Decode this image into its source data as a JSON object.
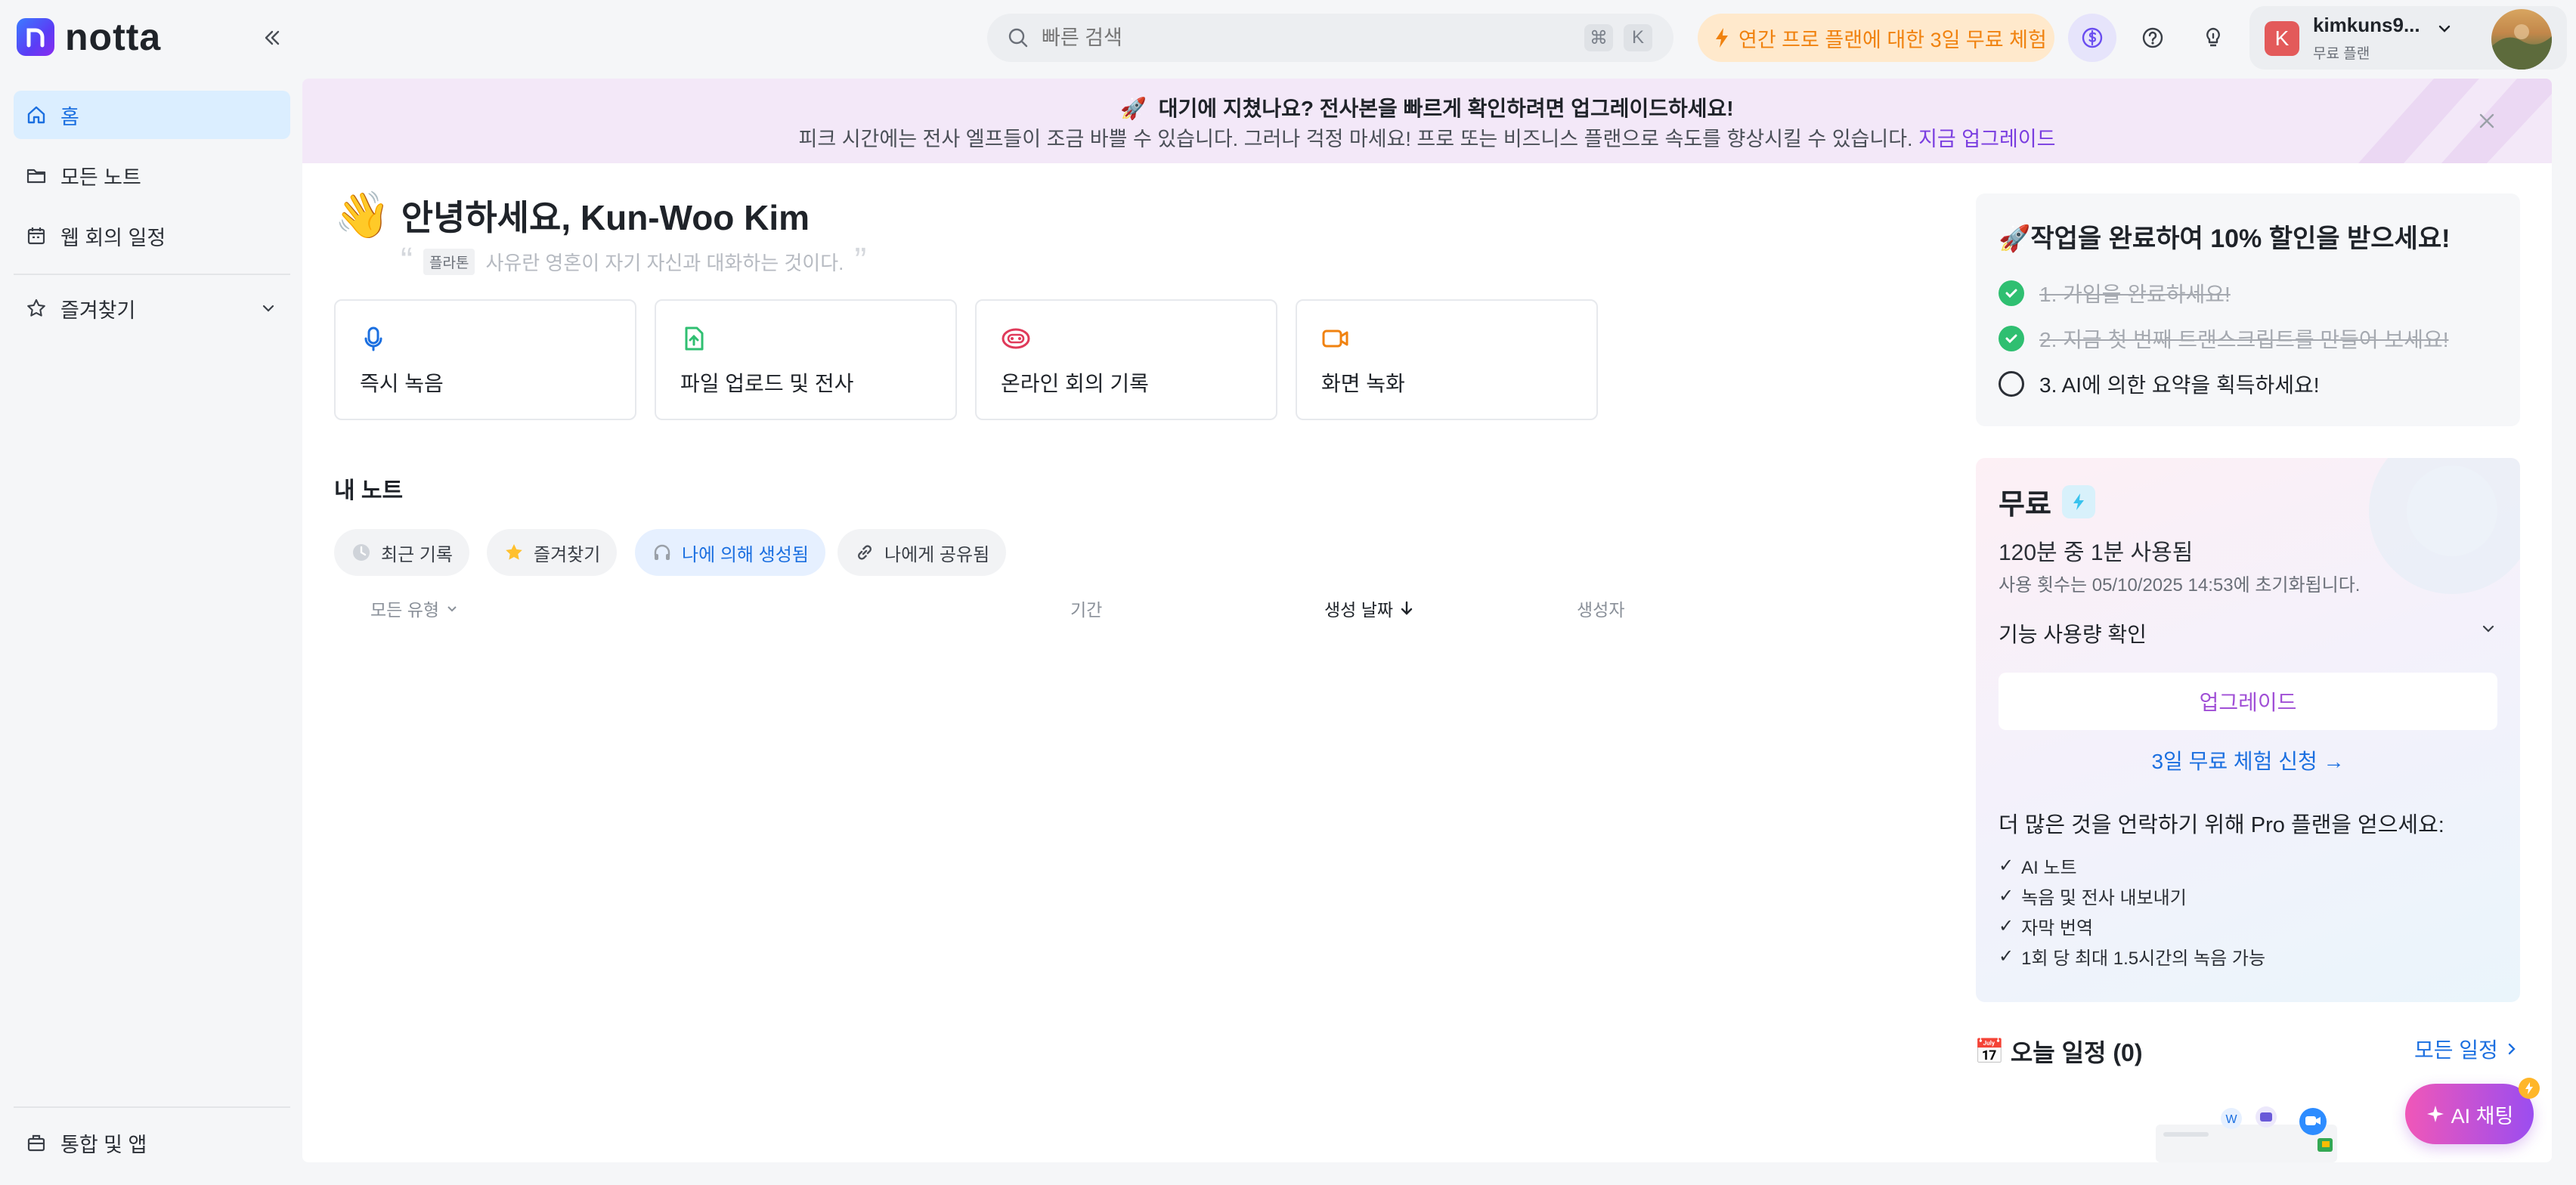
{
  "app": {
    "logo_text": "notta"
  },
  "sidebar": {
    "items": [
      {
        "label": "홈"
      },
      {
        "label": "모든 노트"
      },
      {
        "label": "웹 회의 일정"
      },
      {
        "label": "즐겨찾기"
      }
    ],
    "bottom_item": {
      "label": "통합 및 앱"
    }
  },
  "topbar": {
    "search_placeholder": "빠른 검색",
    "kbd_cmd": "⌘",
    "kbd_key": "K",
    "trial_label": "연간 프로 플랜에 대한 3일 무료 체험",
    "account_name": "kimkuns9...",
    "account_plan": "무료 플랜",
    "account_initial": "K"
  },
  "banner": {
    "title": "대기에 지쳤나요? 전사본을 빠르게 확인하려면 업그레이드하세요!",
    "subtitle": "피크 시간에는 전사 엘프들이 조금 바쁠 수 있습니다. 그러나 걱정 마세요! 프로 또는 비즈니스 플랜으로 속도를 향상시킬 수 있습니다.",
    "link": "지금 업그레이드"
  },
  "greeting": {
    "title": "안녕하세요, Kun-Woo Kim",
    "quote_tag": "플라톤",
    "quote": "사유란 영혼이 자기 자신과 대화하는 것이다."
  },
  "actions": [
    {
      "label": "즉시 녹음"
    },
    {
      "label": "파일 업로드 및 전사"
    },
    {
      "label": "온라인 회의 기록"
    },
    {
      "label": "화면 녹화"
    }
  ],
  "notes": {
    "title": "내 노트",
    "tabs": [
      {
        "label": "최근 기록"
      },
      {
        "label": "즐겨찾기"
      },
      {
        "label": "나에 의해 생성됨"
      },
      {
        "label": "나에게 공유됨"
      }
    ],
    "columns": {
      "type": "모든 유형",
      "duration": "기간",
      "created": "생성 날짜",
      "creator": "생성자"
    }
  },
  "tasks": {
    "title": "작업을 완료하여 10% 할인을 받으세요!",
    "items": [
      {
        "label": "1. 가입을 완료하세요!",
        "done": true
      },
      {
        "label": "2. 지금 첫 번째 트랜스크립트를 만들어 보세요!",
        "done": true
      },
      {
        "label": "3. AI에 의한 요약을 획득하세요!",
        "done": false
      }
    ]
  },
  "plan": {
    "title": "무료",
    "usage": "120분 중 1분 사용됨",
    "reset": "사용 횟수는 05/10/2025 14:53에 초기화됩니다.",
    "features_label": "기능 사용량 확인",
    "upgrade_button": "업그레이드",
    "trial_link": "3일 무료 체험 신청 →",
    "pro_title": "더 많은 것을 언락하기 위해 Pro 플랜을 얻으세요:",
    "pro_items": [
      "AI 노트",
      "녹음 및 전사 내보내기",
      "자막 번역",
      "1회 당 최대 1.5시간의 녹음 가능"
    ]
  },
  "today": {
    "title": "오늘 일정 (0)",
    "all_link": "모든 일정"
  },
  "ai_chat": {
    "label": "AI 채팅"
  },
  "colors": {
    "accent": "#1b6fe0",
    "active_bg": "#dbeeff",
    "trial_orange": "#f0820f",
    "success_green": "#2fbf71",
    "upgrade_purple": "#a04fd6"
  }
}
